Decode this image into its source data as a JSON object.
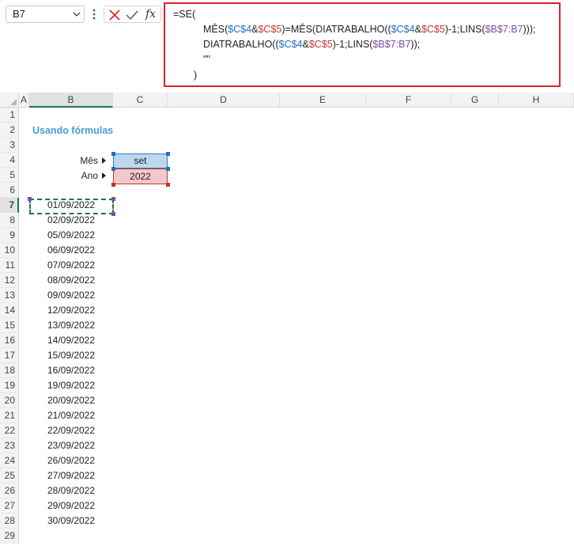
{
  "formula_bar": {
    "name_box": "B7",
    "fx_label": "fx",
    "formula_lines": [
      {
        "parts": [
          {
            "t": "=SE(",
            "c": ""
          }
        ]
      },
      {
        "parts": [
          {
            "t": "MÊS(",
            "c": ""
          },
          {
            "t": "$C$4",
            "c": "ref-blue"
          },
          {
            "t": "&",
            "c": ""
          },
          {
            "t": "$C$5",
            "c": "ref-red"
          },
          {
            "t": ")=MÊS(DIATRABALHO((",
            "c": ""
          },
          {
            "t": "$C$4",
            "c": "ref-blue"
          },
          {
            "t": "&",
            "c": ""
          },
          {
            "t": "$C$5",
            "c": "ref-red"
          },
          {
            "t": ")-1;LINS(",
            "c": ""
          },
          {
            "t": "$B$7:B7",
            "c": "ref-purple"
          },
          {
            "t": ")));",
            "c": ""
          }
        ]
      },
      {
        "parts": [
          {
            "t": "DIATRABALHO((",
            "c": ""
          },
          {
            "t": "$C$4",
            "c": "ref-blue"
          },
          {
            "t": "&",
            "c": ""
          },
          {
            "t": "$C$5",
            "c": "ref-red"
          },
          {
            "t": ")-1;LINS(",
            "c": ""
          },
          {
            "t": "$B$7:B7",
            "c": "ref-purple"
          },
          {
            "t": "));",
            "c": ""
          }
        ]
      },
      {
        "parts": [
          {
            "t": "\"\"",
            "c": ""
          }
        ]
      },
      {
        "parts": [
          {
            "t": ")",
            "c": ""
          }
        ]
      }
    ]
  },
  "sheet": {
    "columns": [
      "A",
      "B",
      "C",
      "D",
      "E",
      "F",
      "G",
      "H"
    ],
    "selected_column": "B",
    "selected_row": "7",
    "rows": [
      "1",
      "2",
      "3",
      "4",
      "5",
      "6",
      "7",
      "8",
      "9",
      "10",
      "11",
      "12",
      "13",
      "14",
      "15",
      "16",
      "17",
      "18",
      "19",
      "20",
      "21",
      "22",
      "23",
      "24",
      "25",
      "26",
      "27",
      "28",
      "29"
    ],
    "title": "Usando fórmulas",
    "month_label": "Mês",
    "year_label": "Ano",
    "month_value": "set",
    "year_value": "2022",
    "dates": [
      "01/09/2022",
      "02/09/2022",
      "05/09/2022",
      "06/09/2022",
      "07/09/2022",
      "08/09/2022",
      "09/09/2022",
      "12/09/2022",
      "13/09/2022",
      "14/09/2022",
      "15/09/2022",
      "16/09/2022",
      "19/09/2022",
      "20/09/2022",
      "21/09/2022",
      "22/09/2022",
      "23/09/2022",
      "26/09/2022",
      "27/09/2022",
      "28/09/2022",
      "29/09/2022",
      "30/09/2022"
    ]
  },
  "colors": {
    "formula_border": "#d8232a",
    "ref_blue": "#1f6fc1",
    "ref_red": "#c0392b",
    "ref_purple": "#7b4fa6",
    "selection_green": "#217346"
  }
}
